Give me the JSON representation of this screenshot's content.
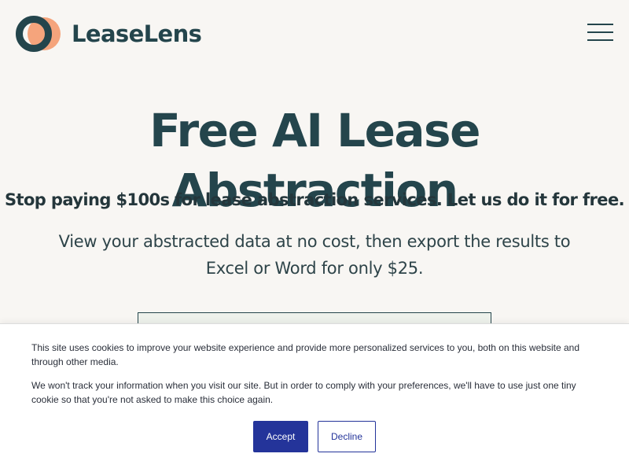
{
  "brand": {
    "name": "LeaseLens",
    "colors": {
      "primary": "#24454c",
      "accent": "#f5a47c",
      "background": "#f8f6f3",
      "button": "#24349a"
    }
  },
  "header": {
    "logo_icon": "overlapping-rings-icon",
    "menu_icon": "hamburger-menu-icon"
  },
  "hero": {
    "title": "Free AI Lease Abstraction",
    "subtitle": "Stop paying $100s for lease abstraction services. Let us do it for free.",
    "description": "View your abstracted data at no cost, then export the results to Excel or Word for only $25."
  },
  "cookie": {
    "text1": "This site uses cookies to improve your website experience and provide more personalized services to you, both on this website and through other media.",
    "text2": "We won't track your information when you visit our site. But in order to comply with your preferences, we'll have to use just one tiny cookie so that you're not asked to make this choice again.",
    "accept_label": "Accept",
    "decline_label": "Decline"
  }
}
